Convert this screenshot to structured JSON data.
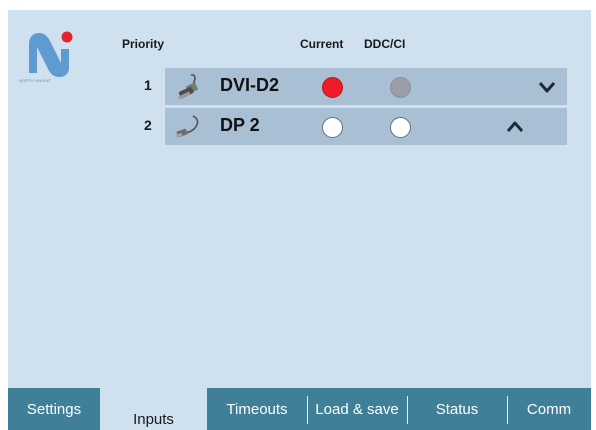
{
  "logo": {
    "letter": "N",
    "tagline": "NORTH INVENT",
    "dot_color": "#e8212e",
    "letter_color": "#5f9bd0"
  },
  "headers": {
    "priority": "Priority",
    "current": "Current",
    "ddcci": "DDC/CI"
  },
  "inputs": [
    {
      "priority": "1",
      "name": "DVI-D2",
      "icon": "dvi-cable-icon",
      "current": "active-red",
      "ddcci": "grey",
      "arrow": "down-chevron-icon"
    },
    {
      "priority": "2",
      "name": "DP 2",
      "icon": "displayport-cable-icon",
      "current": "empty",
      "ddcci": "empty",
      "arrow": "up-chevron-icon"
    }
  ],
  "tabs": [
    {
      "label": "Settings",
      "active": false
    },
    {
      "label": "Inputs",
      "active": true
    },
    {
      "label": "Timeouts",
      "active": false
    },
    {
      "label": "Load & save",
      "active": false
    },
    {
      "label": "Status",
      "active": false
    },
    {
      "label": "Comm",
      "active": false
    }
  ],
  "colors": {
    "background": "#cfe0ee",
    "row": "#a9bfd3",
    "tab": "#3f7f97",
    "current_red": "#ee1b2a",
    "ddc_grey": "#9b9ea8"
  }
}
